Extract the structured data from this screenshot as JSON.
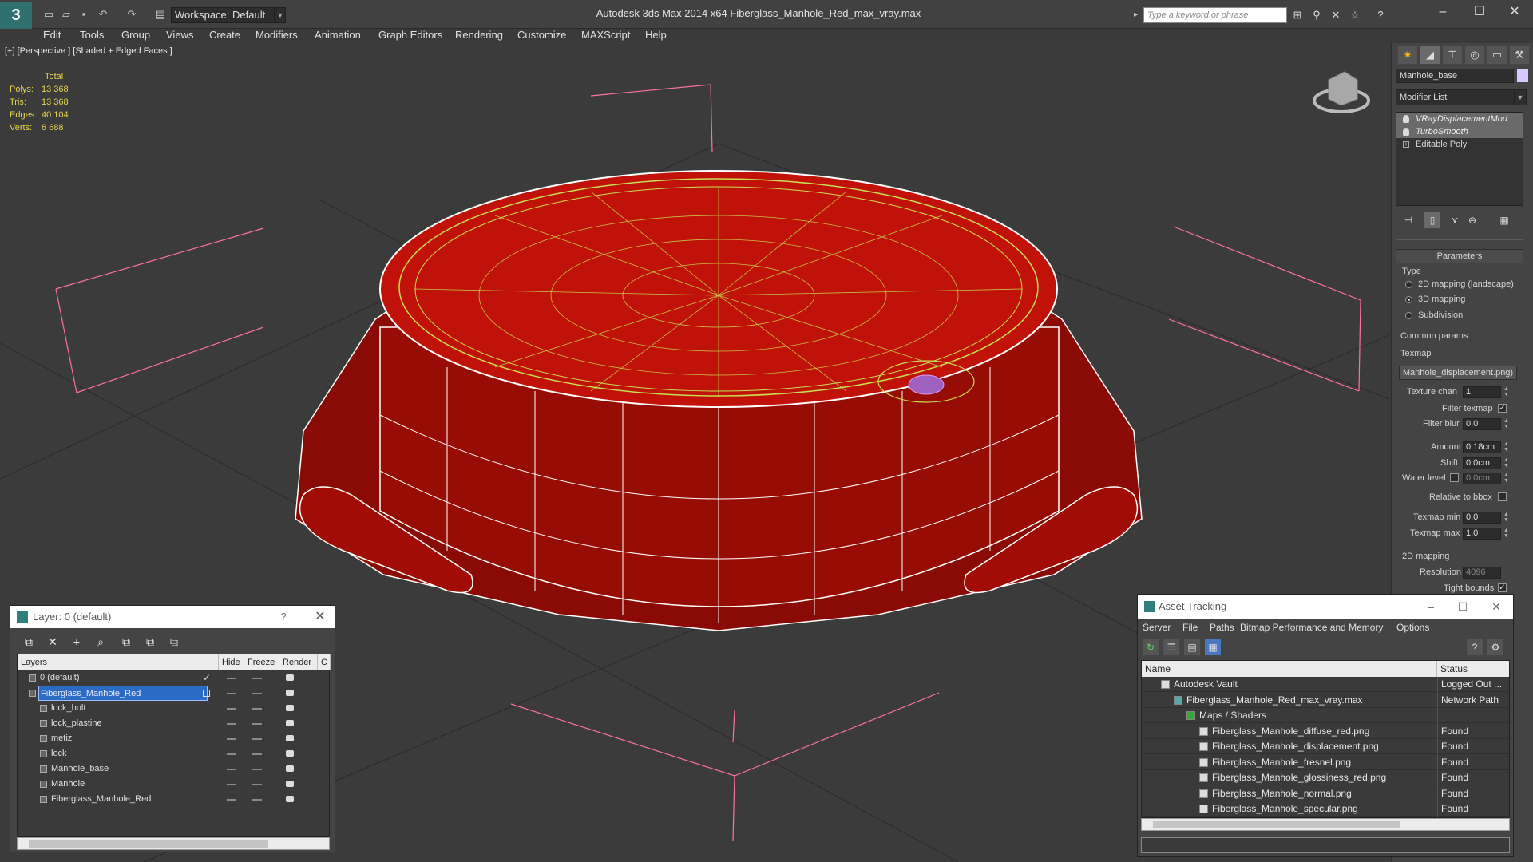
{
  "app": {
    "title": "Autodesk 3ds Max  2014 x64      Fiberglass_Manhole_Red_max_vray.max",
    "workspace": "Workspace: Default",
    "search_placeholder": "Type a keyword or phrase"
  },
  "menu": [
    "Edit",
    "Tools",
    "Group",
    "Views",
    "Create",
    "Modifiers",
    "Animation",
    "Graph Editors",
    "Rendering",
    "Customize",
    "MAXScript",
    "Help"
  ],
  "viewport": {
    "label": "[+] [Perspective ] [Shaded + Edged Faces ]",
    "stats": {
      "header": "Total",
      "rows": [
        {
          "label": "Polys:",
          "value": "13 368"
        },
        {
          "label": "Tris:",
          "value": "13 368"
        },
        {
          "label": "Edges:",
          "value": "40 104"
        },
        {
          "label": "Verts:",
          "value": "6 688"
        }
      ]
    }
  },
  "command_panel": {
    "object_name": "Manhole_base",
    "modifier_list": "Modifier List",
    "stack": [
      "VRayDisplacementMod",
      "TurboSmooth",
      "Editable Poly"
    ],
    "params_title": "Parameters",
    "type_label": "Type",
    "type_options": [
      "2D mapping (landscape)",
      "3D mapping",
      "Subdivision"
    ],
    "common_params": "Common params",
    "texmap_label": "Texmap",
    "texmap_value": "Manhole_displacement.png)",
    "texture_chan": {
      "label": "Texture chan",
      "value": "1"
    },
    "filter_texmap": "Filter texmap",
    "filter_blur": {
      "label": "Filter blur",
      "value": "0.0"
    },
    "amount": {
      "label": "Amount",
      "value": "0.18cm"
    },
    "shift": {
      "label": "Shift",
      "value": "0.0cm"
    },
    "water_level": {
      "label": "Water level",
      "value": "0.0cm"
    },
    "relative_to_bbox": "Relative to bbox",
    "texmap_min": {
      "label": "Texmap min",
      "value": "0.0"
    },
    "texmap_max": {
      "label": "Texmap max",
      "value": "1.0"
    },
    "mapping_2d": "2D mapping",
    "resolution": {
      "label": "Resolution",
      "value": "4096"
    },
    "tight_bounds": "Tight bounds"
  },
  "layer_dialog": {
    "title": "Layer: 0 (default)",
    "help": "?",
    "columns": [
      "Layers",
      "Hide",
      "Freeze",
      "Render",
      "C"
    ],
    "rows": [
      {
        "name": "0 (default)",
        "indent": 1,
        "selected": false
      },
      {
        "name": "Fiberglass_Manhole_Red",
        "indent": 1,
        "selected": true
      },
      {
        "name": "lock_bolt",
        "indent": 2,
        "selected": false
      },
      {
        "name": "lock_plastine",
        "indent": 2,
        "selected": false
      },
      {
        "name": "metiz",
        "indent": 2,
        "selected": false
      },
      {
        "name": "lock",
        "indent": 2,
        "selected": false
      },
      {
        "name": "Manhole_base",
        "indent": 2,
        "selected": false
      },
      {
        "name": "Manhole",
        "indent": 2,
        "selected": false
      },
      {
        "name": "Fiberglass_Manhole_Red",
        "indent": 2,
        "selected": false
      }
    ]
  },
  "asset_dialog": {
    "title": "Asset Tracking",
    "menu": [
      "Server",
      "File",
      "Paths",
      "Bitmap Performance and Memory",
      "Options"
    ],
    "columns": [
      "Name",
      "Status"
    ],
    "rows": [
      {
        "name": "Autodesk Vault",
        "status": "Logged Out ..."
      },
      {
        "name": "Fiberglass_Manhole_Red_max_vray.max",
        "status": "Network Path"
      },
      {
        "name": "Maps / Shaders",
        "status": ""
      },
      {
        "name": "Fiberglass_Manhole_diffuse_red.png",
        "status": "Found"
      },
      {
        "name": "Fiberglass_Manhole_displacement.png",
        "status": "Found"
      },
      {
        "name": "Fiberglass_Manhole_fresnel.png",
        "status": "Found"
      },
      {
        "name": "Fiberglass_Manhole_glossiness_red.png",
        "status": "Found"
      },
      {
        "name": "Fiberglass_Manhole_normal.png",
        "status": "Found"
      },
      {
        "name": "Fiberglass_Manhole_specular.png",
        "status": "Found"
      }
    ]
  },
  "colors": {
    "model_red": "#b01008",
    "wire": "#ffffff",
    "selection_wire": "#c8e050",
    "grid": "#ff6fa8",
    "viewport_bg": "#3b3b3b"
  }
}
